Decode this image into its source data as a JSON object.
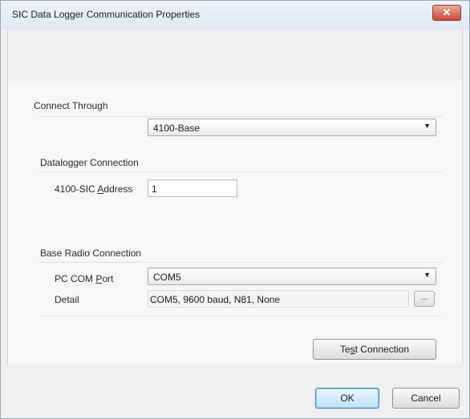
{
  "window": {
    "title": "SIC Data Logger Communication Properties",
    "close_glyph": "✕"
  },
  "connect_through": {
    "heading": "Connect Through",
    "value": "4100-Base"
  },
  "datalogger": {
    "heading": "Datalogger Connection",
    "address_label_pre": "4100-SIC ",
    "address_label_accel": "A",
    "address_label_post": "ddress",
    "address_value": "1"
  },
  "base_radio": {
    "heading": "Base Radio Connection",
    "port_label_pre": "PC COM ",
    "port_label_accel": "P",
    "port_label_post": "ort",
    "port_value": "COM5",
    "detail_label": "Detail",
    "detail_value": "COM5, 9600 baud, N81, None",
    "detail_button": "..."
  },
  "test_connection": {
    "label_pre": "Te",
    "label_accel": "s",
    "label_post": "t Connection"
  },
  "footer": {
    "ok_label": "OK",
    "cancel_label": "Cancel"
  },
  "colors": {
    "dialog_bg": "#f0f0f0",
    "close_button": "#c9473a",
    "default_button_border": "#3c7fb1"
  }
}
